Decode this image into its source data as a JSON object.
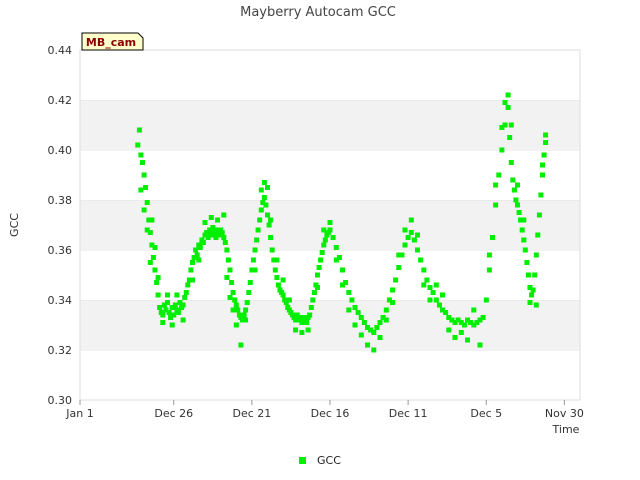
{
  "chart_data": {
    "type": "scatter",
    "title": "Mayberry Autocam GCC",
    "xlabel": "Time",
    "ylabel": "GCC",
    "badge": "MB_cam",
    "ylim": [
      0.3,
      0.44
    ],
    "xlim": [
      0,
      32
    ],
    "x_axis_note": "time runs right-to-left (reversed); x = days before Jan 1",
    "y_ticks": [
      "0.30",
      "0.32",
      "0.34",
      "0.36",
      "0.38",
      "0.40",
      "0.42",
      "0.44"
    ],
    "x_ticks": [
      {
        "value": 0,
        "label": "Jan 1"
      },
      {
        "value": 6,
        "label": "Dec 26"
      },
      {
        "value": 11,
        "label": "Dec 21"
      },
      {
        "value": 16,
        "label": "Dec 16"
      },
      {
        "value": 21,
        "label": "Dec 11"
      },
      {
        "value": 26,
        "label": "Dec 5"
      },
      {
        "value": 31,
        "label": "Nov 30"
      }
    ],
    "grid": "alternating horizontal bands",
    "legend_position": "bottom-center",
    "series": [
      {
        "name": "GCC",
        "color": "#00ee00",
        "points": [
          [
            3.7,
            0.402
          ],
          [
            3.8,
            0.408
          ],
          [
            3.9,
            0.398
          ],
          [
            4.0,
            0.395
          ],
          [
            4.1,
            0.39
          ],
          [
            4.2,
            0.385
          ],
          [
            4.3,
            0.379
          ],
          [
            4.4,
            0.372
          ],
          [
            4.5,
            0.367
          ],
          [
            4.6,
            0.362
          ],
          [
            4.7,
            0.357
          ],
          [
            4.8,
            0.352
          ],
          [
            4.9,
            0.347
          ],
          [
            5.0,
            0.342
          ],
          [
            5.1,
            0.337
          ],
          [
            5.2,
            0.335
          ],
          [
            5.3,
            0.334
          ],
          [
            5.4,
            0.338
          ],
          [
            5.5,
            0.336
          ],
          [
            5.6,
            0.339
          ],
          [
            5.7,
            0.335
          ],
          [
            5.8,
            0.333
          ],
          [
            5.9,
            0.337
          ],
          [
            6.0,
            0.334
          ],
          [
            6.1,
            0.338
          ],
          [
            6.2,
            0.336
          ],
          [
            6.3,
            0.335
          ],
          [
            6.4,
            0.339
          ],
          [
            6.5,
            0.337
          ],
          [
            6.6,
            0.338
          ],
          [
            6.7,
            0.341
          ],
          [
            6.8,
            0.343
          ],
          [
            6.9,
            0.346
          ],
          [
            7.0,
            0.348
          ],
          [
            7.1,
            0.352
          ],
          [
            7.2,
            0.355
          ],
          [
            7.3,
            0.357
          ],
          [
            7.4,
            0.36
          ],
          [
            7.5,
            0.358
          ],
          [
            7.6,
            0.362
          ],
          [
            7.7,
            0.361
          ],
          [
            7.8,
            0.364
          ],
          [
            7.9,
            0.363
          ],
          [
            8.0,
            0.366
          ],
          [
            8.1,
            0.367
          ],
          [
            8.2,
            0.365
          ],
          [
            8.3,
            0.368
          ],
          [
            8.4,
            0.366
          ],
          [
            8.5,
            0.369
          ],
          [
            8.6,
            0.367
          ],
          [
            8.7,
            0.365
          ],
          [
            8.8,
            0.368
          ],
          [
            8.9,
            0.366
          ],
          [
            9.0,
            0.368
          ],
          [
            9.1,
            0.367
          ],
          [
            9.2,
            0.365
          ],
          [
            9.3,
            0.363
          ],
          [
            9.4,
            0.36
          ],
          [
            9.5,
            0.356
          ],
          [
            9.6,
            0.352
          ],
          [
            9.7,
            0.347
          ],
          [
            9.8,
            0.343
          ],
          [
            9.9,
            0.34
          ],
          [
            10.0,
            0.338
          ],
          [
            10.1,
            0.336
          ],
          [
            10.2,
            0.334
          ],
          [
            10.3,
            0.333
          ],
          [
            10.4,
            0.332
          ],
          [
            10.5,
            0.334
          ],
          [
            10.6,
            0.336
          ],
          [
            10.7,
            0.339
          ],
          [
            10.8,
            0.343
          ],
          [
            10.9,
            0.347
          ],
          [
            11.0,
            0.352
          ],
          [
            11.1,
            0.356
          ],
          [
            11.2,
            0.36
          ],
          [
            11.3,
            0.364
          ],
          [
            11.4,
            0.368
          ],
          [
            11.5,
            0.372
          ],
          [
            11.6,
            0.376
          ],
          [
            11.7,
            0.379
          ],
          [
            11.8,
            0.381
          ],
          [
            11.9,
            0.378
          ],
          [
            12.0,
            0.374
          ],
          [
            12.1,
            0.37
          ],
          [
            12.2,
            0.365
          ],
          [
            12.3,
            0.36
          ],
          [
            12.4,
            0.356
          ],
          [
            12.5,
            0.352
          ],
          [
            12.6,
            0.349
          ],
          [
            12.7,
            0.346
          ],
          [
            12.8,
            0.344
          ],
          [
            12.9,
            0.343
          ],
          [
            13.0,
            0.342
          ],
          [
            13.1,
            0.34
          ],
          [
            13.2,
            0.339
          ],
          [
            13.3,
            0.337
          ],
          [
            13.4,
            0.336
          ],
          [
            13.5,
            0.335
          ],
          [
            13.6,
            0.334
          ],
          [
            13.7,
            0.333
          ],
          [
            13.8,
            0.332
          ],
          [
            13.9,
            0.334
          ],
          [
            14.0,
            0.333
          ],
          [
            14.1,
            0.332
          ],
          [
            14.2,
            0.331
          ],
          [
            14.3,
            0.333
          ],
          [
            14.4,
            0.332
          ],
          [
            14.5,
            0.331
          ],
          [
            14.6,
            0.333
          ],
          [
            14.7,
            0.334
          ],
          [
            14.8,
            0.337
          ],
          [
            14.9,
            0.34
          ],
          [
            15.0,
            0.343
          ],
          [
            15.1,
            0.346
          ],
          [
            15.2,
            0.35
          ],
          [
            15.3,
            0.353
          ],
          [
            15.4,
            0.356
          ],
          [
            15.5,
            0.359
          ],
          [
            15.6,
            0.362
          ],
          [
            15.7,
            0.364
          ],
          [
            15.8,
            0.366
          ],
          [
            15.9,
            0.367
          ],
          [
            16.0,
            0.368
          ],
          [
            16.2,
            0.365
          ],
          [
            16.4,
            0.361
          ],
          [
            16.6,
            0.357
          ],
          [
            16.8,
            0.352
          ],
          [
            17.0,
            0.347
          ],
          [
            17.2,
            0.343
          ],
          [
            17.4,
            0.34
          ],
          [
            17.6,
            0.337
          ],
          [
            17.8,
            0.335
          ],
          [
            18.0,
            0.333
          ],
          [
            18.2,
            0.331
          ],
          [
            18.4,
            0.329
          ],
          [
            18.6,
            0.328
          ],
          [
            18.8,
            0.327
          ],
          [
            19.0,
            0.329
          ],
          [
            19.2,
            0.331
          ],
          [
            19.4,
            0.333
          ],
          [
            19.6,
            0.336
          ],
          [
            19.8,
            0.34
          ],
          [
            20.0,
            0.344
          ],
          [
            20.2,
            0.348
          ],
          [
            20.4,
            0.353
          ],
          [
            20.6,
            0.358
          ],
          [
            20.8,
            0.362
          ],
          [
            21.0,
            0.365
          ],
          [
            21.2,
            0.367
          ],
          [
            21.4,
            0.364
          ],
          [
            21.6,
            0.36
          ],
          [
            21.8,
            0.356
          ],
          [
            22.0,
            0.352
          ],
          [
            22.2,
            0.348
          ],
          [
            22.4,
            0.345
          ],
          [
            22.6,
            0.343
          ],
          [
            22.8,
            0.34
          ],
          [
            23.0,
            0.338
          ],
          [
            23.2,
            0.336
          ],
          [
            23.4,
            0.335
          ],
          [
            23.6,
            0.333
          ],
          [
            23.8,
            0.332
          ],
          [
            24.0,
            0.331
          ],
          [
            24.2,
            0.332
          ],
          [
            24.4,
            0.331
          ],
          [
            24.6,
            0.33
          ],
          [
            24.8,
            0.332
          ],
          [
            25.0,
            0.331
          ],
          [
            25.2,
            0.33
          ],
          [
            25.4,
            0.331
          ],
          [
            25.6,
            0.332
          ],
          [
            25.8,
            0.333
          ],
          [
            26.0,
            0.34
          ],
          [
            26.2,
            0.352
          ],
          [
            26.4,
            0.365
          ],
          [
            26.6,
            0.378
          ],
          [
            26.8,
            0.39
          ],
          [
            27.0,
            0.4
          ],
          [
            27.2,
            0.41
          ],
          [
            27.4,
            0.417
          ],
          [
            27.5,
            0.405
          ],
          [
            27.6,
            0.395
          ],
          [
            27.7,
            0.388
          ],
          [
            27.8,
            0.384
          ],
          [
            27.9,
            0.38
          ],
          [
            28.0,
            0.378
          ],
          [
            28.1,
            0.375
          ],
          [
            28.2,
            0.372
          ],
          [
            28.3,
            0.368
          ],
          [
            28.4,
            0.364
          ],
          [
            28.5,
            0.36
          ],
          [
            28.6,
            0.355
          ],
          [
            28.7,
            0.35
          ],
          [
            28.8,
            0.345
          ],
          [
            28.9,
            0.342
          ],
          [
            29.0,
            0.344
          ],
          [
            29.1,
            0.35
          ],
          [
            29.2,
            0.358
          ],
          [
            29.3,
            0.366
          ],
          [
            29.4,
            0.374
          ],
          [
            29.5,
            0.382
          ],
          [
            29.6,
            0.39
          ],
          [
            29.7,
            0.398
          ],
          [
            29.8,
            0.403
          ],
          [
            3.9,
            0.384
          ],
          [
            4.1,
            0.376
          ],
          [
            4.3,
            0.368
          ],
          [
            4.5,
            0.355
          ],
          [
            4.6,
            0.372
          ],
          [
            4.8,
            0.361
          ],
          [
            5.0,
            0.349
          ],
          [
            5.3,
            0.331
          ],
          [
            5.6,
            0.342
          ],
          [
            5.9,
            0.33
          ],
          [
            6.2,
            0.342
          ],
          [
            6.6,
            0.332
          ],
          [
            7.2,
            0.348
          ],
          [
            7.6,
            0.356
          ],
          [
            8.0,
            0.371
          ],
          [
            8.4,
            0.373
          ],
          [
            8.8,
            0.372
          ],
          [
            9.2,
            0.374
          ],
          [
            9.4,
            0.349
          ],
          [
            9.6,
            0.341
          ],
          [
            9.8,
            0.336
          ],
          [
            10.0,
            0.33
          ],
          [
            10.3,
            0.322
          ],
          [
            10.6,
            0.332
          ],
          [
            11.2,
            0.352
          ],
          [
            11.6,
            0.384
          ],
          [
            11.8,
            0.387
          ],
          [
            12.0,
            0.385
          ],
          [
            12.2,
            0.372
          ],
          [
            12.6,
            0.356
          ],
          [
            13.0,
            0.348
          ],
          [
            13.4,
            0.34
          ],
          [
            13.8,
            0.328
          ],
          [
            14.2,
            0.327
          ],
          [
            14.6,
            0.328
          ],
          [
            15.2,
            0.345
          ],
          [
            15.6,
            0.368
          ],
          [
            16.0,
            0.371
          ],
          [
            16.4,
            0.356
          ],
          [
            16.8,
            0.346
          ],
          [
            17.2,
            0.336
          ],
          [
            17.6,
            0.33
          ],
          [
            18.0,
            0.326
          ],
          [
            18.4,
            0.322
          ],
          [
            18.8,
            0.32
          ],
          [
            19.2,
            0.325
          ],
          [
            19.6,
            0.332
          ],
          [
            20.0,
            0.339
          ],
          [
            20.4,
            0.358
          ],
          [
            20.8,
            0.368
          ],
          [
            21.2,
            0.372
          ],
          [
            21.6,
            0.366
          ],
          [
            22.0,
            0.346
          ],
          [
            22.4,
            0.34
          ],
          [
            22.8,
            0.346
          ],
          [
            23.2,
            0.342
          ],
          [
            23.6,
            0.328
          ],
          [
            24.0,
            0.325
          ],
          [
            24.4,
            0.327
          ],
          [
            24.8,
            0.324
          ],
          [
            25.2,
            0.336
          ],
          [
            25.6,
            0.322
          ],
          [
            26.2,
            0.358
          ],
          [
            26.6,
            0.386
          ],
          [
            27.0,
            0.409
          ],
          [
            27.2,
            0.419
          ],
          [
            27.4,
            0.422
          ],
          [
            27.6,
            0.41
          ],
          [
            28.0,
            0.386
          ],
          [
            28.4,
            0.372
          ],
          [
            28.8,
            0.339
          ],
          [
            29.2,
            0.338
          ],
          [
            29.6,
            0.394
          ],
          [
            29.8,
            0.406
          ]
        ]
      }
    ]
  }
}
